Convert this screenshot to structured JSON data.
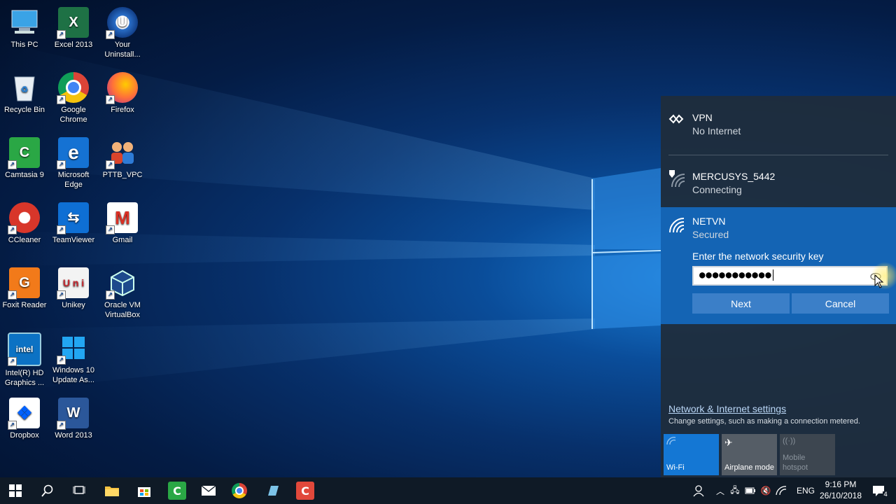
{
  "desktop": {
    "icons": [
      {
        "label": "This PC"
      },
      {
        "label": "Excel 2013"
      },
      {
        "label": "Your Uninstall..."
      },
      {
        "label": "Recycle Bin"
      },
      {
        "label": "Google Chrome"
      },
      {
        "label": "Firefox"
      },
      {
        "label": "Camtasia 9"
      },
      {
        "label": "Microsoft Edge"
      },
      {
        "label": "PTTB_VPC"
      },
      {
        "label": "CCleaner"
      },
      {
        "label": "TeamViewer"
      },
      {
        "label": "Gmail"
      },
      {
        "label": "Foxit Reader"
      },
      {
        "label": "Unikey"
      },
      {
        "label": "Oracle VM VirtualBox"
      },
      {
        "label": "Intel(R) HD Graphics ..."
      },
      {
        "label": "Windows 10 Update As..."
      },
      {
        "label": "Dropbox"
      },
      {
        "label": "Word 2013"
      }
    ]
  },
  "network_flyout": {
    "networks": [
      {
        "name": "VPN",
        "status": "No Internet",
        "icon": "vpn-icon"
      },
      {
        "name": "MERCUSYS_5442",
        "status": "Connecting",
        "icon": "wifi-secured-icon"
      },
      {
        "name": "NETVN",
        "status": "Secured",
        "icon": "wifi-icon"
      }
    ],
    "key_prompt": "Enter the network security key",
    "password_value": "●●●●●●●●●●●",
    "next_label": "Next",
    "cancel_label": "Cancel",
    "settings_link": "Network & Internet settings",
    "settings_desc": "Change settings, such as making a connection metered.",
    "quick_actions": [
      {
        "label": "Wi-Fi",
        "state": "on",
        "color": "#1477d4"
      },
      {
        "label": "Airplane mode",
        "state": "off",
        "color": "#555d66"
      },
      {
        "label": "Mobile hotspot",
        "state": "disabled",
        "color": "#3d4650"
      }
    ]
  },
  "taskbar": {
    "apps": [
      "start-icon",
      "search-icon",
      "task-view-icon",
      "file-explorer-icon",
      "store-icon",
      "camtasia-icon",
      "mail-icon",
      "chrome-icon",
      "notepad-icon",
      "ccleaner-icon"
    ],
    "language": "ENG",
    "time": "9:16 PM",
    "date": "26/10/2018",
    "notification_count": "4"
  }
}
